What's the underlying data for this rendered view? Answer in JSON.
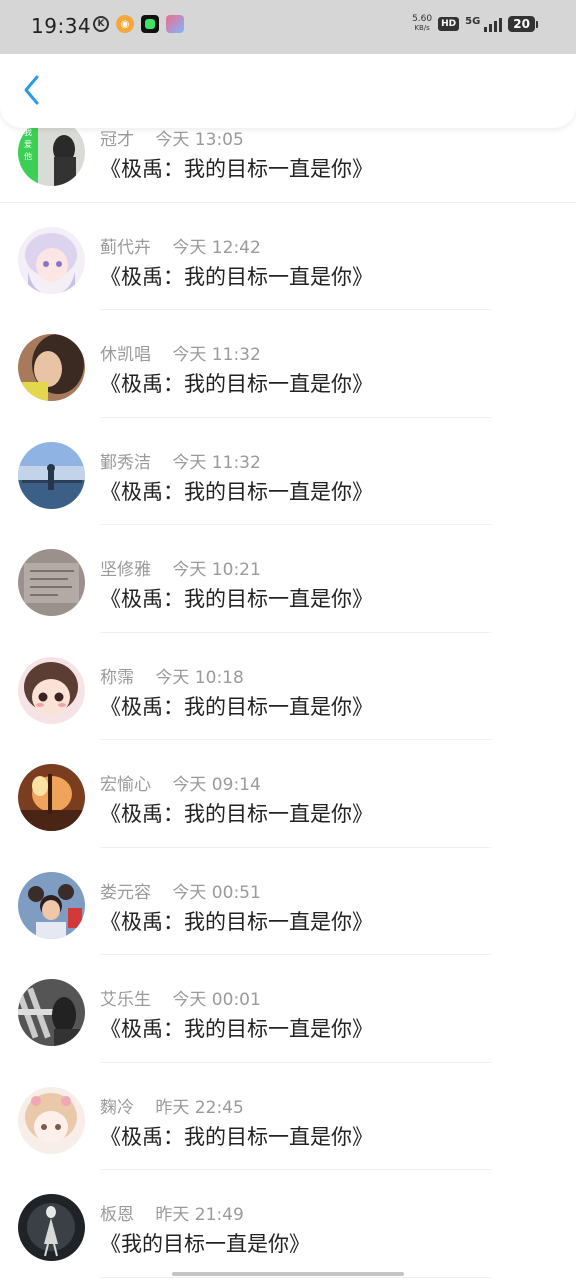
{
  "status_bar": {
    "time": "19:34",
    "net_speed_value": "5.60",
    "net_speed_unit": "KB/s",
    "hd": "HD",
    "network": "5G",
    "battery": "20",
    "icons": [
      "k-icon",
      "weibo-icon",
      "green-app-icon",
      "game-app-icon"
    ]
  },
  "header": {
    "back_icon": "chevron-left-icon",
    "accent_color": "#2b9ae6"
  },
  "comments": [
    {
      "user": "冠才",
      "time": "今天 13:05",
      "text": "《极禹：我的目标一直是你》"
    },
    {
      "user": "蓟代卉",
      "time": "今天 12:42",
      "text": "《极禹：我的目标一直是你》"
    },
    {
      "user": "休凯唱",
      "time": "今天 11:32",
      "text": "《极禹：我的目标一直是你》"
    },
    {
      "user": "鄞秀洁",
      "time": "今天 11:32",
      "text": "《极禹：我的目标一直是你》"
    },
    {
      "user": "坚修雅",
      "time": "今天 10:21",
      "text": "《极禹：我的目标一直是你》"
    },
    {
      "user": "称霈",
      "time": "今天 10:18",
      "text": "《极禹：我的目标一直是你》"
    },
    {
      "user": "宏愉心",
      "time": "今天 09:14",
      "text": "《极禹：我的目标一直是你》"
    },
    {
      "user": "娄元容",
      "time": "今天 00:51",
      "text": "《极禹：我的目标一直是你》"
    },
    {
      "user": "艾乐生",
      "time": "今天 00:01",
      "text": "《极禹：我的目标一直是你》"
    },
    {
      "user": "麴冷",
      "time": "昨天 22:45",
      "text": "《极禹：我的目标一直是你》"
    },
    {
      "user": "板恩",
      "time": "昨天 21:49",
      "text": "《我的目标一直是你》"
    }
  ]
}
